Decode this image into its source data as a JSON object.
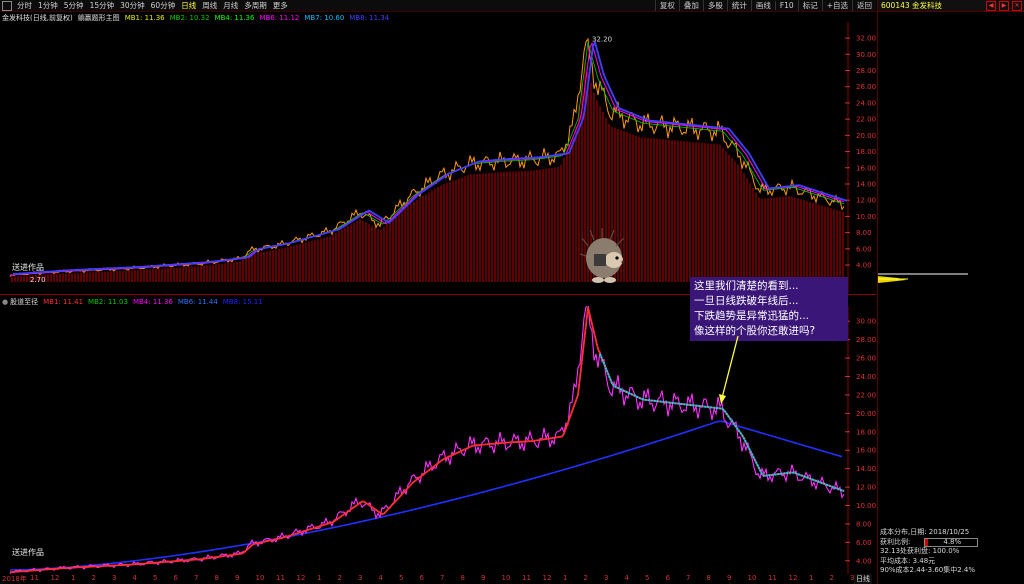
{
  "toolbar": {
    "period_items": [
      "分时",
      "1分钟",
      "5分钟",
      "15分钟",
      "30分钟",
      "60分钟",
      "日线",
      "周线",
      "月线",
      "多周期",
      "更多"
    ],
    "active_item": "日线",
    "right_items": [
      "复权",
      "叠加",
      "多股",
      "统计",
      "画线",
      "F10",
      "标记",
      "+自选",
      "返回"
    ]
  },
  "stock": {
    "code_name": "600143 金发科技"
  },
  "main_chart": {
    "title": "金发科技(日线,前复权)",
    "indicator_name": "躺赢题形主图",
    "mas": [
      {
        "label": "MB1: 11.36",
        "color": "#e8ec00"
      },
      {
        "label": "MB2: 10.32",
        "color": "#00c800"
      },
      {
        "label": "MB4: 11.36",
        "color": "#00ff00"
      },
      {
        "label": "MB6: 11.12",
        "color": "#ff00ff"
      },
      {
        "label": "MB7: 10.60",
        "color": "#00c0ff"
      },
      {
        "label": "MB8: 11.34",
        "color": "#4040ff"
      }
    ],
    "peak_label": "32.20",
    "low_label": "2.70",
    "watermark": "送进作品",
    "y_ticks": [
      "32.00",
      "30.00",
      "28.00",
      "26.00",
      "24.00",
      "22.00",
      "20.00",
      "18.00",
      "16.00",
      "14.00",
      "12.00",
      "10.00",
      "8.00",
      "6.00",
      "4.00"
    ]
  },
  "sub_chart": {
    "indicator_name": "股道至径",
    "mas": [
      {
        "label": "MB1: 11.41",
        "color": "#ff3030"
      },
      {
        "label": "MB2: 11.03",
        "color": "#00c800"
      },
      {
        "label": "MB4: 11.36",
        "color": "#ff00ff"
      },
      {
        "label": "MB6: 11.44",
        "color": "#3070ff"
      },
      {
        "label": "MB8: 15.11",
        "color": "#2020ff"
      }
    ],
    "watermark": "送进作品",
    "y_ticks": [
      "30.00",
      "28.00",
      "26.00",
      "24.00",
      "22.00",
      "20.00",
      "18.00",
      "16.00",
      "14.00",
      "12.00",
      "10.00",
      "8.00",
      "6.00",
      "4.00"
    ]
  },
  "annotation": {
    "lines": [
      "这里我们清楚的看到...",
      "一旦日线跌破年线后...",
      "下跌趋势是异常迅猛的...",
      "像这样的个股你还敢进吗?"
    ]
  },
  "x_axis": {
    "year_label": "2018年",
    "ticks": [
      "11",
      "12",
      "1",
      "2",
      "3",
      "4",
      "5",
      "6",
      "7",
      "8",
      "9",
      "10",
      "11",
      "12",
      "1",
      "2",
      "3",
      "4",
      "5",
      "6",
      "7",
      "8",
      "9",
      "10",
      "11",
      "12",
      "1",
      "2",
      "3",
      "4",
      "5",
      "6",
      "7",
      "8",
      "9",
      "10",
      "11",
      "12",
      "1",
      "2",
      "3"
    ],
    "period_label": "日线"
  },
  "cost_distribution": {
    "title": "成本分布,日期: 2018/10/25",
    "profit_label": "获利比例:",
    "profit_value": "4.8%",
    "profit_line": "32.13处获利盘: 100.0%",
    "avg_cost": "平均成本: 3.48元",
    "cost_range": "90%成本2.44-3.60集中2.4%"
  },
  "colors": {
    "up": "#ff3030",
    "down": "#00ffff",
    "volume": "#7a0000",
    "grid": "#3a0000"
  },
  "icons": [
    "window-icon",
    "mascot-hedgehog-icon",
    "close-icon"
  ]
}
